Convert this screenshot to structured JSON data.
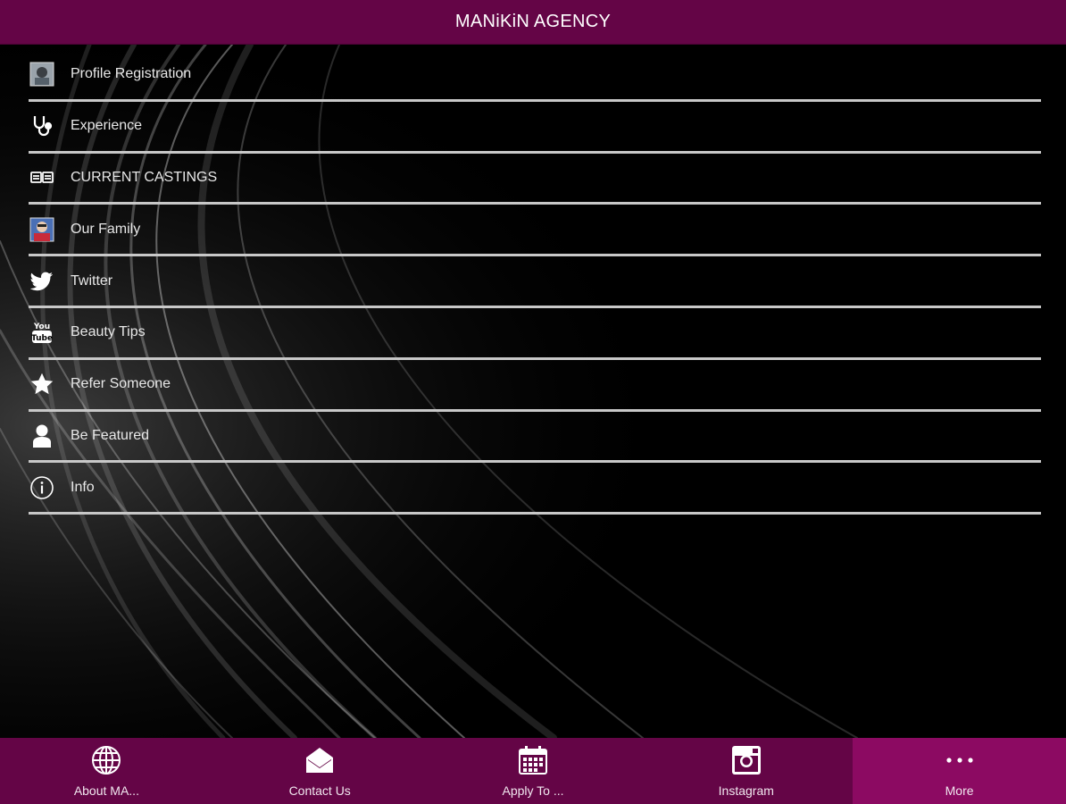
{
  "header": {
    "title": "MANiKiN AGENCY"
  },
  "menu": {
    "items": [
      {
        "label": "Profile Registration",
        "icon": "profile-photo-icon"
      },
      {
        "label": "Experience",
        "icon": "stethoscope-icon"
      },
      {
        "label": "CURRENT CASTINGS",
        "icon": "ticket-icon"
      },
      {
        "label": "Our Family",
        "icon": "family-photo-icon"
      },
      {
        "label": "Twitter",
        "icon": "twitter-bird-icon"
      },
      {
        "label": "Beauty Tips",
        "icon": "youtube-icon"
      },
      {
        "label": "Refer Someone",
        "icon": "star-icon"
      },
      {
        "label": "Be Featured",
        "icon": "person-icon"
      },
      {
        "label": "Info",
        "icon": "info-icon"
      }
    ]
  },
  "tabbar": {
    "tabs": [
      {
        "label": "About MA...",
        "icon": "globe-icon"
      },
      {
        "label": "Contact Us",
        "icon": "envelope-icon"
      },
      {
        "label": "Apply To ...",
        "icon": "calendar-icon"
      },
      {
        "label": "Instagram",
        "icon": "instagram-icon"
      },
      {
        "label": "More",
        "icon": "more-dots-icon"
      }
    ]
  },
  "colors": {
    "brand": "#640546",
    "active_tab": "#8c0a62",
    "divider": "#c8c8c8"
  }
}
